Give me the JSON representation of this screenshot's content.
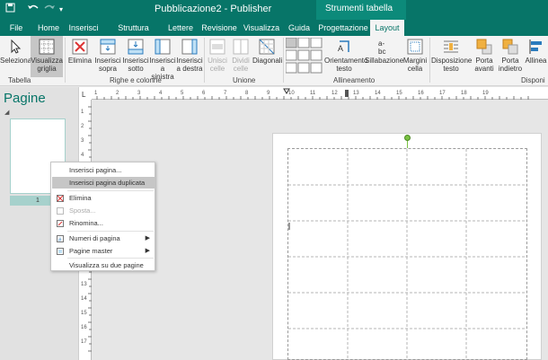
{
  "titlebar": {
    "save_icon": "save-icon",
    "undo_icon": "undo-icon",
    "redo_icon": "redo-icon",
    "customize_icon": "customize-qat-icon",
    "title": "Pubblicazione2 - Publisher",
    "tools_group": "Strumenti tabella"
  },
  "tabs": [
    {
      "label": "File"
    },
    {
      "label": "Home"
    },
    {
      "label": "Inserisci"
    },
    {
      "label": "Struttura pagina"
    },
    {
      "label": "Lettere"
    },
    {
      "label": "Revisione"
    },
    {
      "label": "Visualizza"
    },
    {
      "label": "Guida"
    },
    {
      "label": "Progettazione"
    },
    {
      "label": "Layout"
    }
  ],
  "ribbon": {
    "buttons": [
      {
        "label": "Seleziona",
        "icon": "select-cursor-icon"
      },
      {
        "label": "Visualizza griglia",
        "icon": "view-gridlines-icon"
      },
      {
        "label": "Elimina",
        "icon": "delete-table-icon"
      },
      {
        "label": "Inserisci sopra",
        "icon": "insert-above-icon"
      },
      {
        "label": "Inserisci sotto",
        "icon": "insert-below-icon"
      },
      {
        "label": "Inserisci a sinistra",
        "icon": "insert-left-icon"
      },
      {
        "label": "Inserisci a destra",
        "icon": "insert-right-icon"
      },
      {
        "label": "Unisci celle",
        "icon": "merge-cells-icon"
      },
      {
        "label": "Dividi celle",
        "icon": "split-cells-icon"
      },
      {
        "label": "Diagonali",
        "icon": "diagonals-icon"
      },
      {
        "label": "Orientamento testo",
        "icon": "text-direction-icon"
      },
      {
        "label": "Sillabazione",
        "icon": "hyphenation-icon"
      },
      {
        "label": "Margini cella",
        "icon": "cell-margins-icon"
      },
      {
        "label": "Disposizione testo",
        "icon": "wrap-text-icon"
      },
      {
        "label": "Porta avanti",
        "icon": "bring-forward-icon"
      },
      {
        "label": "Porta indietro",
        "icon": "send-backward-icon"
      },
      {
        "label": "Allinea",
        "icon": "align-icon"
      }
    ],
    "groups": [
      {
        "label": "Tabella"
      },
      {
        "label": "Righe e colonne"
      },
      {
        "label": "Unione"
      },
      {
        "label": "Allineamento"
      },
      {
        "label": "Disponi"
      }
    ]
  },
  "pages_pane": {
    "title": "Pagine",
    "page_number": "1"
  },
  "context_menu": {
    "items": [
      {
        "label": "Inserisci pagina...",
        "icon": ""
      },
      {
        "label": "Inserisci pagina duplicata",
        "icon": ""
      },
      {
        "label": "Elimina",
        "icon": "delete-page-icon"
      },
      {
        "label": "Sposta...",
        "icon": "move-page-icon"
      },
      {
        "label": "Rinomina...",
        "icon": "rename-icon"
      },
      {
        "label": "Numeri di pagina",
        "icon": "page-numbers-icon"
      },
      {
        "label": "Pagine master",
        "icon": "master-pages-icon"
      },
      {
        "label": "Visualizza su due pagine",
        "icon": ""
      }
    ]
  },
  "ruler": {
    "vertical_labels": [
      "1",
      "2",
      "3",
      "4",
      "5",
      "6",
      "7",
      "8",
      "9",
      "10",
      "11",
      "12",
      "13",
      "14",
      "15",
      "16",
      "17"
    ],
    "horizontal_labels": [
      "1",
      "2",
      "3",
      "4",
      "5",
      "6",
      "7",
      "8",
      "9",
      "10",
      "11",
      "12",
      "13",
      "14",
      "15",
      "16",
      "17",
      "18",
      "19"
    ]
  },
  "colors": {
    "brand": "#077568",
    "ribbon_bg": "#f3f3f3",
    "pane_bg": "#e1e1e1",
    "canvas_bg": "#e6e6e6",
    "highlight": "#c6c6c6"
  }
}
